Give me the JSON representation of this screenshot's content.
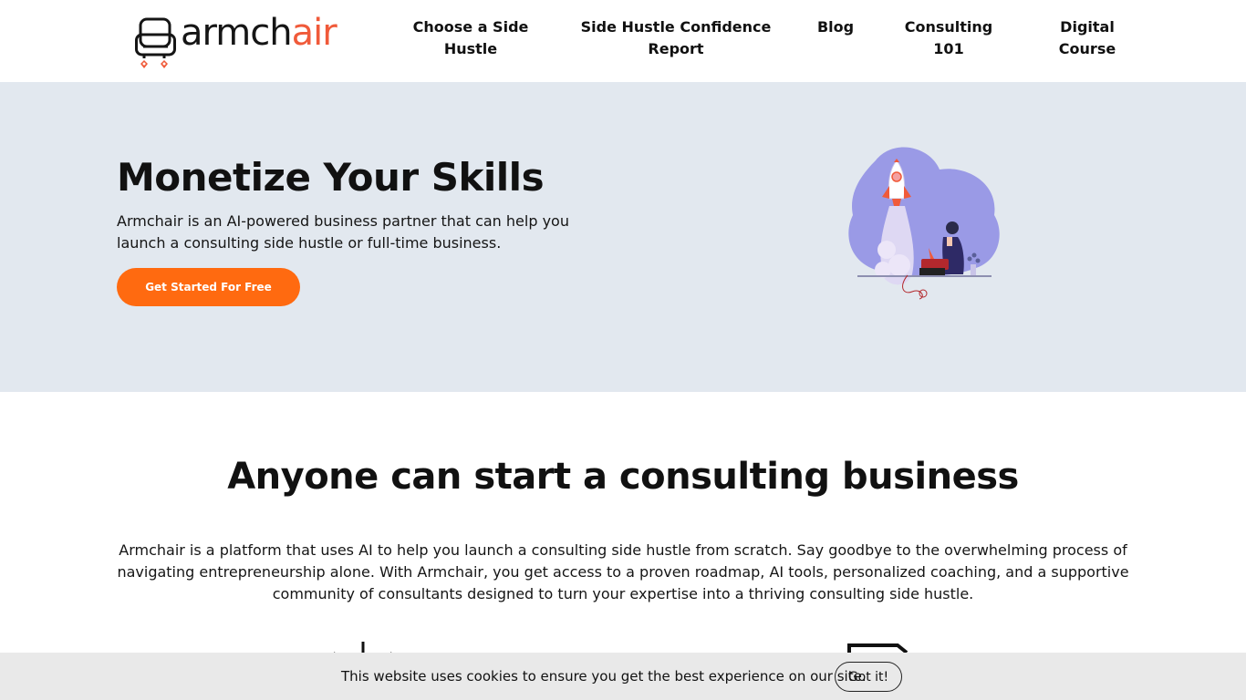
{
  "header": {
    "logo": {
      "text_main": "armch",
      "text_accent": "air",
      "text_tail": ""
    },
    "nav": [
      {
        "label": "Choose a Side\nHustle"
      },
      {
        "label": "Side Hustle Confidence\nReport"
      },
      {
        "label": "Blog"
      },
      {
        "label": "Consulting\n101"
      },
      {
        "label": "Digital\nCourse"
      }
    ]
  },
  "hero": {
    "title": "Monetize Your Skills",
    "subtitle": "Armchair is an AI-powered business partner that can help you launch a consulting side hustle or full-time business.",
    "cta_label": "Get Started For Free",
    "illustration_icon": "rocket-launch-illustration"
  },
  "intro": {
    "title": "Anyone can start a consulting business",
    "body": "Armchair is a platform that uses AI to help you launch a consulting side hustle from scratch. Say goodbye to the overwhelming process of navigating entrepreneurship alone. With Armchair, you get access to a proven roadmap, AI tools, personalized coaching, and a supportive community of consultants designed to turn your expertise into a thriving consulting side hustle."
  },
  "cookie": {
    "message": "This website uses cookies to ensure you get the best experience on our site.",
    "button_label": "Got it!"
  },
  "colors": {
    "accent": "#ff6a10",
    "logo_accent": "#f05a3a",
    "hero_bg": "#e2e8ef",
    "cookie_bg": "#e9e9e9"
  }
}
